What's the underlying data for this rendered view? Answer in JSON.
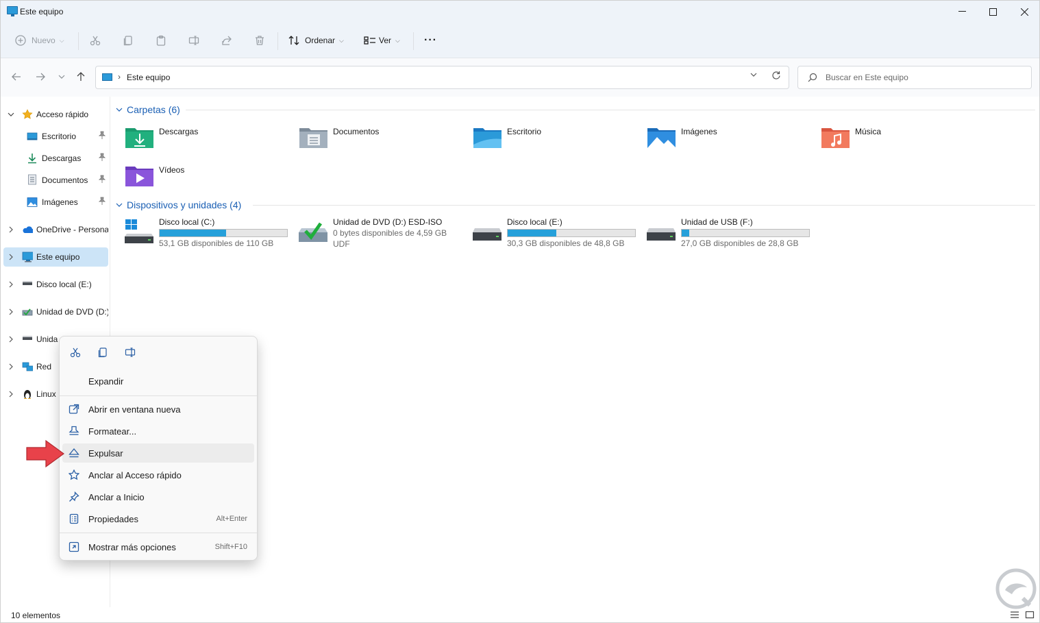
{
  "window": {
    "title": "Este equipo",
    "controls": {
      "minimize": "—",
      "maximize": "☐",
      "close": "✕"
    }
  },
  "toolbar": {
    "new_label": "Nuevo",
    "sort_label": "Ordenar",
    "view_label": "Ver",
    "more_label": "···"
  },
  "address": {
    "crumb": "Este equipo",
    "search_placeholder": "Buscar en Este equipo"
  },
  "sidebar": {
    "items": [
      {
        "label": "Acceso rápido",
        "icon": "star-icon"
      },
      {
        "label": "Escritorio",
        "icon": "desktop-icon"
      },
      {
        "label": "Descargas",
        "icon": "download-icon"
      },
      {
        "label": "Documentos",
        "icon": "documents-icon"
      },
      {
        "label": "Imágenes",
        "icon": "pictures-icon"
      },
      {
        "label": "OneDrive - Personal",
        "icon": "onedrive-icon"
      },
      {
        "label": "Este equipo",
        "icon": "pc-icon"
      },
      {
        "label": "Disco local (E:)",
        "icon": "drive-icon"
      },
      {
        "label": "Unidad de DVD (D:)",
        "icon": "dvd-icon"
      },
      {
        "label": "Unida",
        "icon": "drive-icon"
      },
      {
        "label": "Red",
        "icon": "network-icon"
      },
      {
        "label": "Linux",
        "icon": "linux-icon"
      }
    ]
  },
  "content": {
    "folders_header": "Carpetas (6)",
    "folders": [
      {
        "name": "Descargas"
      },
      {
        "name": "Documentos"
      },
      {
        "name": "Escritorio"
      },
      {
        "name": "Imágenes"
      },
      {
        "name": "Música"
      },
      {
        "name": "Vídeos"
      }
    ],
    "drives_header": "Dispositivos y unidades (4)",
    "drives": [
      {
        "name": "Disco local (C:)",
        "free": "53,1 GB disponibles de 110 GB",
        "used_fraction": 0.52
      },
      {
        "name": "Unidad de DVD (D:) ESD-ISO",
        "free": "0 bytes disponibles de 4,59 GB",
        "fs": "UDF"
      },
      {
        "name": "Disco local (E:)",
        "free": "30,3 GB disponibles de 48,8 GB",
        "used_fraction": 0.38
      },
      {
        "name": "Unidad de USB (F:)",
        "free": "27,0 GB disponibles de 28,8 GB",
        "used_fraction": 0.06
      }
    ]
  },
  "context_menu": {
    "items": [
      {
        "label": "Expandir"
      },
      {
        "label": "Abrir en ventana nueva"
      },
      {
        "label": "Formatear..."
      },
      {
        "label": "Expulsar"
      },
      {
        "label": "Anclar al Acceso rápido"
      },
      {
        "label": "Anclar a Inicio"
      },
      {
        "label": "Propiedades",
        "shortcut": "Alt+Enter"
      },
      {
        "label": "Mostrar más opciones",
        "shortcut": "Shift+F10"
      }
    ]
  },
  "status": {
    "text": "10 elementos"
  },
  "colors": {
    "accent": "#26a0da",
    "selected": "#cce4f7",
    "header_blue": "#1a5fb4",
    "arrow_red": "#e8424a"
  }
}
